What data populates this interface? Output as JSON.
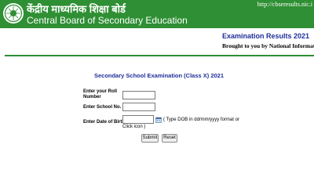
{
  "header": {
    "title_hindi": "केंद्रीय माध्यमिक शिक्षा बोर्ड",
    "title_english": "Central Board of Secondary Education",
    "url": "http://cbseresults.nic.i",
    "logo": "cbse-emblem",
    "color": "#2f8f34"
  },
  "banner": {
    "exam_results": "Examination Results 2021",
    "brought_by": "Brought to you by National Informatics Centre"
  },
  "form": {
    "title": "Secondary School Examination (Class X) 2021",
    "roll_label": "Enter your Roll Number",
    "roll_value": "",
    "school_label": "Enter School No.",
    "school_value": "",
    "dob_label": "Enter Date of Birth",
    "dob_value": "",
    "dob_hint": "( Type DOB in dd/mm/yyyy format or Click icon )",
    "calendar_icon": "calendar-icon",
    "submit_label": "Submit",
    "reset_label": "Reset"
  }
}
